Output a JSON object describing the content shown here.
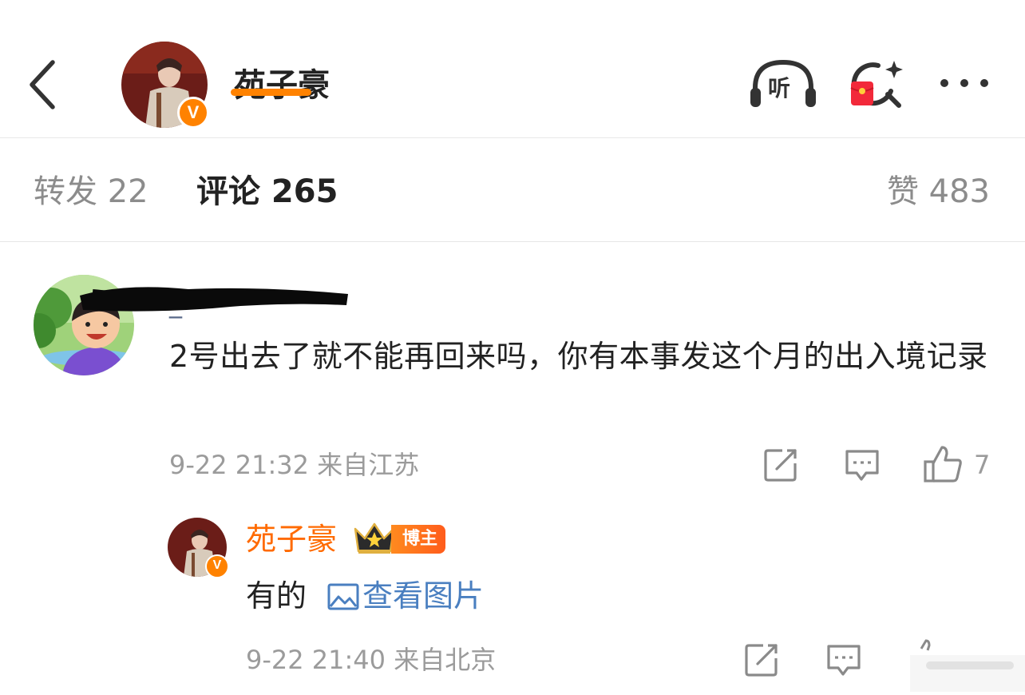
{
  "header": {
    "title": "苑子豪",
    "verified_badge": "V",
    "listen_label": "听",
    "icons": [
      "back-icon",
      "listen-headphone-icon",
      "red-packet-search-icon",
      "more-icon"
    ]
  },
  "tabs": [
    {
      "label": "转发 22",
      "active": false
    },
    {
      "label": "评论 265",
      "active": true
    },
    {
      "label": "赞 483",
      "active": false
    }
  ],
  "comment": {
    "author": "_",
    "text": "2号出去了就不能再回来吗，你有本事发这个月的出入境记录",
    "meta": "9-22 21:32 来自江苏",
    "like_count": "7"
  },
  "reply": {
    "author": "苑子豪",
    "badge": "博主",
    "verified_badge": "V",
    "text": "有的",
    "link_text": "查看图片",
    "meta": "9-22 21:40 来自北京"
  },
  "colors": {
    "accent": "#ff8200",
    "author_highlight": "#ff6a00",
    "link": "#4a7fc0",
    "meta_text": "#9b9b9b"
  }
}
